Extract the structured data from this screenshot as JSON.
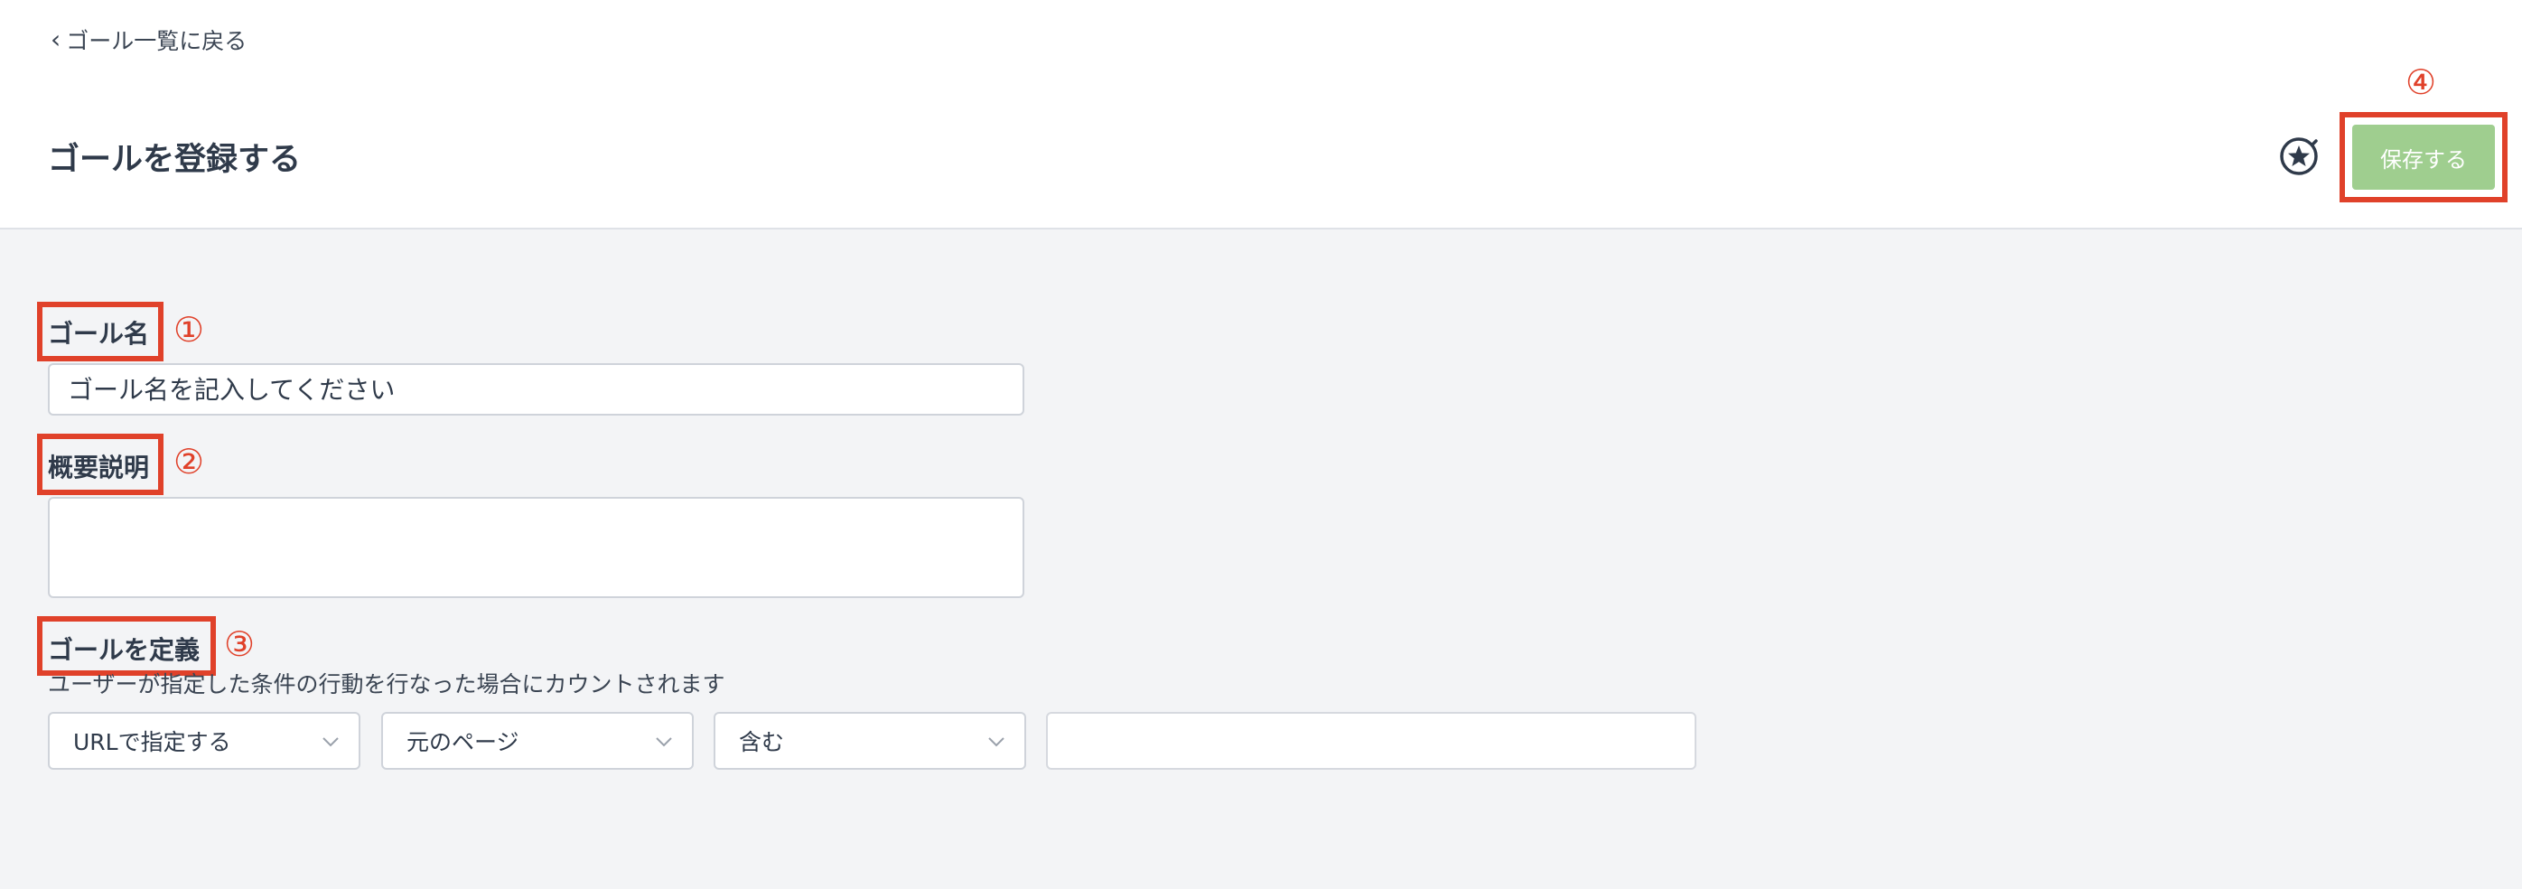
{
  "header": {
    "back_link": "ゴール一覧に戻る",
    "page_title": "ゴールを登録する",
    "save_label": "保存する",
    "star_icon": "star-circle-icon"
  },
  "annotations": {
    "n1": "①",
    "n2": "②",
    "n3": "③",
    "n4": "④",
    "color": "#e0412a"
  },
  "form": {
    "goal_name_label": "ゴール名",
    "goal_name_placeholder": "ゴール名を記入してください",
    "goal_name_value": "",
    "summary_label": "概要説明",
    "summary_value": "",
    "define_label": "ゴールを定義",
    "define_description": "ユーザーが指定した条件の行動を行なった場合にカウントされます",
    "conditions": {
      "select_type": "URLで指定する",
      "select_page": "元のページ",
      "select_match": "含む",
      "value": ""
    }
  },
  "colors": {
    "accent_save": "#9fce8f",
    "annotation": "#e0412a",
    "background": "#f3f4f6"
  }
}
